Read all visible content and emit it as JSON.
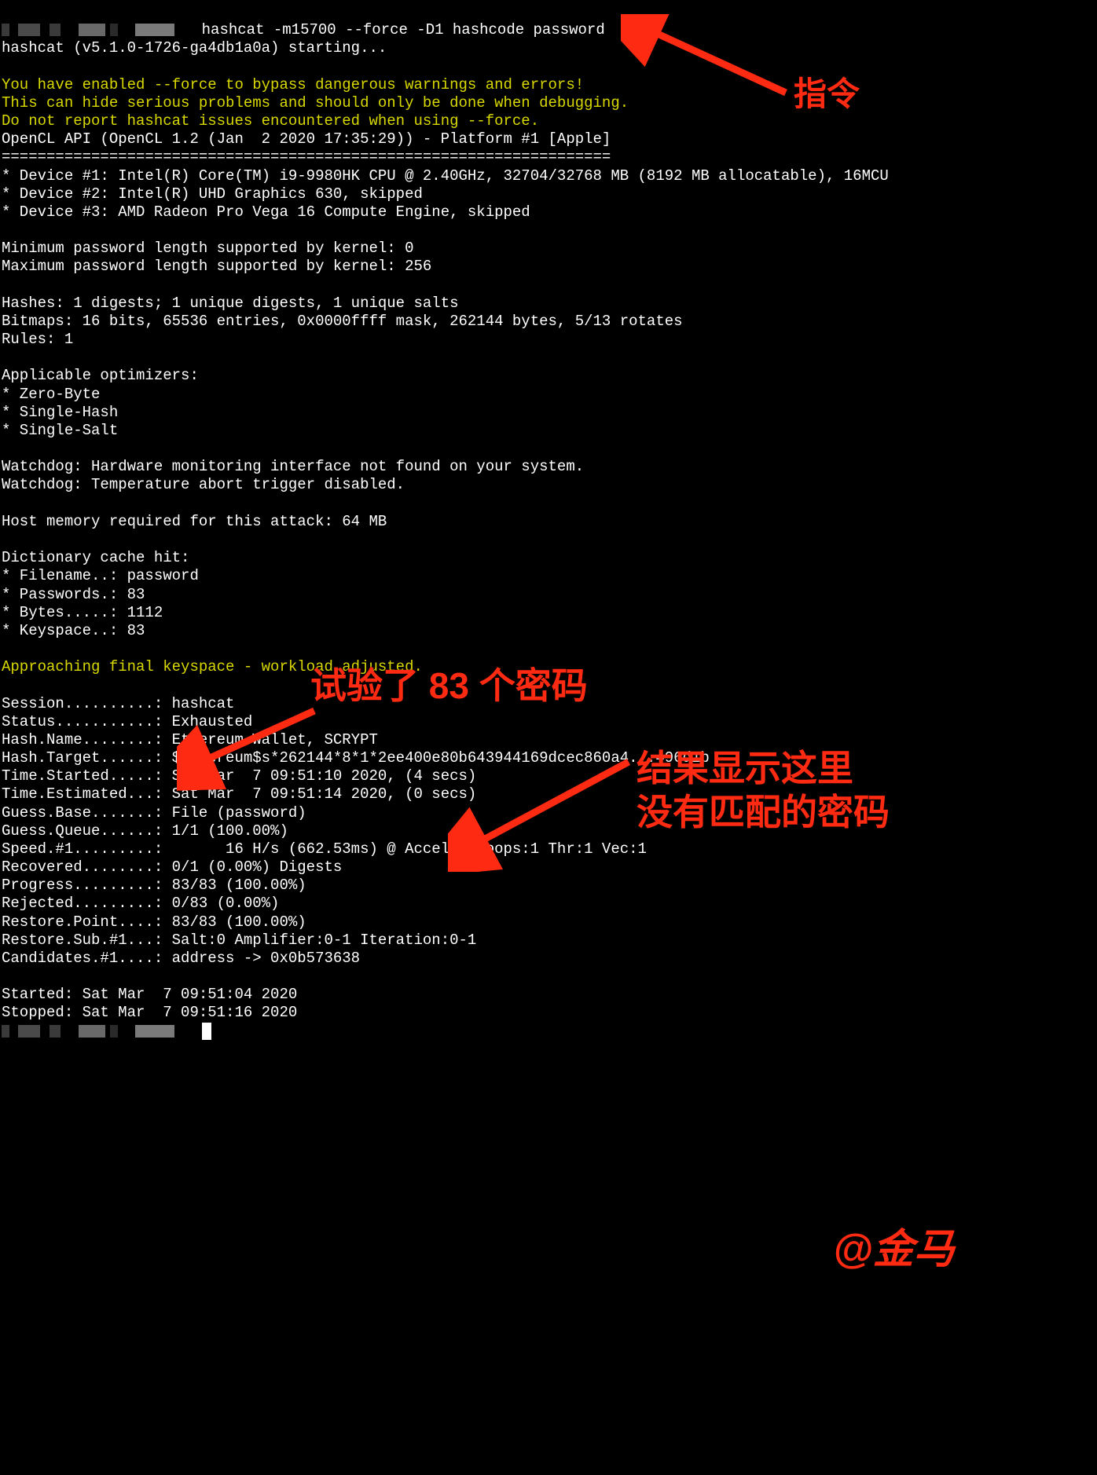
{
  "prompt_cmd": "hashcat -m15700 --force -D1 hashcode password",
  "starting": "hashcat (v5.1.0-1726-ga4db1a0a) starting...",
  "warn1": "You have enabled --force to bypass dangerous warnings and errors!",
  "warn2": "This can hide serious problems and should only be done when debugging.",
  "warn3": "Do not report hashcat issues encountered when using --force.",
  "opencl": "OpenCL API (OpenCL 1.2 (Jan  2 2020 17:35:29)) - Platform #1 [Apple]",
  "hr": "====================================================================",
  "dev1": "* Device #1: Intel(R) Core(TM) i9-9980HK CPU @ 2.40GHz, 32704/32768 MB (8192 MB allocatable), 16MCU",
  "dev2": "* Device #2: Intel(R) UHD Graphics 630, skipped",
  "dev3": "* Device #3: AMD Radeon Pro Vega 16 Compute Engine, skipped",
  "minp": "Minimum password length supported by kernel: 0",
  "maxp": "Maximum password length supported by kernel: 256",
  "hashes": "Hashes: 1 digests; 1 unique digests, 1 unique salts",
  "bitmaps": "Bitmaps: 16 bits, 65536 entries, 0x0000ffff mask, 262144 bytes, 5/13 rotates",
  "rules": "Rules: 1",
  "app_opt_hdr": "Applicable optimizers:",
  "opt1": "* Zero-Byte",
  "opt2": "* Single-Hash",
  "opt3": "* Single-Salt",
  "wd1": "Watchdog: Hardware monitoring interface not found on your system.",
  "wd2": "Watchdog: Temperature abort trigger disabled.",
  "hostmem": "Host memory required for this attack: 64 MB",
  "dict_hdr": "Dictionary cache hit:",
  "dict1": "* Filename..: password",
  "dict2": "* Passwords.: 83",
  "dict3": "* Bytes.....: 1112",
  "dict4": "* Keyspace..: 83",
  "approach": "Approaching final keyspace - workload adjusted.",
  "s_session": "Session..........: hashcat",
  "s_status": "Status...........: Exhausted",
  "s_hashname": "Hash.Name........: Ethereum Wallet, SCRYPT",
  "s_target": "Hash.Target......: $ethereum$s*262144*8*1*2ee400e80b643944169dcec860a4...496d1b",
  "s_started": "Time.Started.....: Sat Mar  7 09:51:10 2020, (4 secs)",
  "s_est": "Time.Estimated...: Sat Mar  7 09:51:14 2020, (0 secs)",
  "s_gbase": "Guess.Base.......: File (password)",
  "s_gqueue": "Guess.Queue......: 1/1 (100.00%)",
  "s_speed": "Speed.#1.........:       16 H/s (662.53ms) @ Accel:1 Loops:1 Thr:1 Vec:1",
  "s_recov": "Recovered........: 0/1 (0.00%) Digests",
  "s_prog": "Progress.........: 83/83 (100.00%)",
  "s_rej": "Rejected.........: 0/83 (0.00%)",
  "s_restore": "Restore.Point....: 83/83 (100.00%)",
  "s_rsub": "Restore.Sub.#1...: Salt:0 Amplifier:0-1 Iteration:0-1",
  "s_cand": "Candidates.#1....: address -> 0x0b573638",
  "started": "Started: Sat Mar  7 09:51:04 2020",
  "stopped": "Stopped: Sat Mar  7 09:51:16 2020",
  "annot": {
    "cmd": "指令",
    "tried": "试验了 83 个密码",
    "nores1": "结果显示这里",
    "nores2": "没有匹配的密码",
    "sig": "@金马"
  },
  "colors": {
    "red": "#ff2a12",
    "yellow": "#d8d800"
  }
}
